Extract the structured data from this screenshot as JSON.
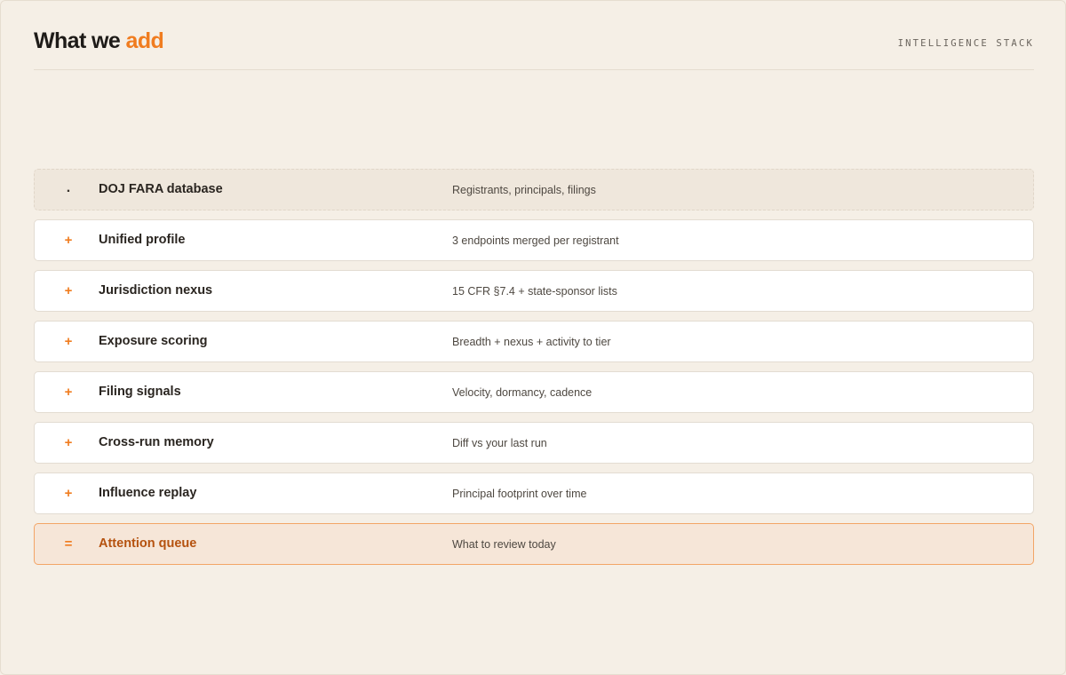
{
  "header": {
    "title_main": "What we ",
    "title_accent": "add",
    "stack_label": "INTELLIGENCE STACK"
  },
  "colors": {
    "accent": "#f07c1f",
    "background": "#f5efe6",
    "highlight_border": "#f3a566",
    "highlight_text": "#b5520f"
  },
  "rows": [
    {
      "marker": ".",
      "name": "DOJ FARA database",
      "desc": "Registrants, principals, filings",
      "kind": "base"
    },
    {
      "marker": "+",
      "name": "Unified profile",
      "desc": "3 endpoints merged per registrant",
      "kind": "added"
    },
    {
      "marker": "+",
      "name": "Jurisdiction nexus",
      "desc": "15 CFR §7.4 + state-sponsor lists",
      "kind": "added"
    },
    {
      "marker": "+",
      "name": "Exposure scoring",
      "desc": "Breadth + nexus + activity to tier",
      "kind": "added"
    },
    {
      "marker": "+",
      "name": "Filing signals",
      "desc": "Velocity, dormancy, cadence",
      "kind": "added"
    },
    {
      "marker": "+",
      "name": "Cross-run memory",
      "desc": "Diff vs your last run",
      "kind": "added"
    },
    {
      "marker": "+",
      "name": "Influence replay",
      "desc": "Principal footprint over time",
      "kind": "added"
    },
    {
      "marker": "=",
      "name": "Attention queue",
      "desc": "What to review today",
      "kind": "result"
    }
  ]
}
